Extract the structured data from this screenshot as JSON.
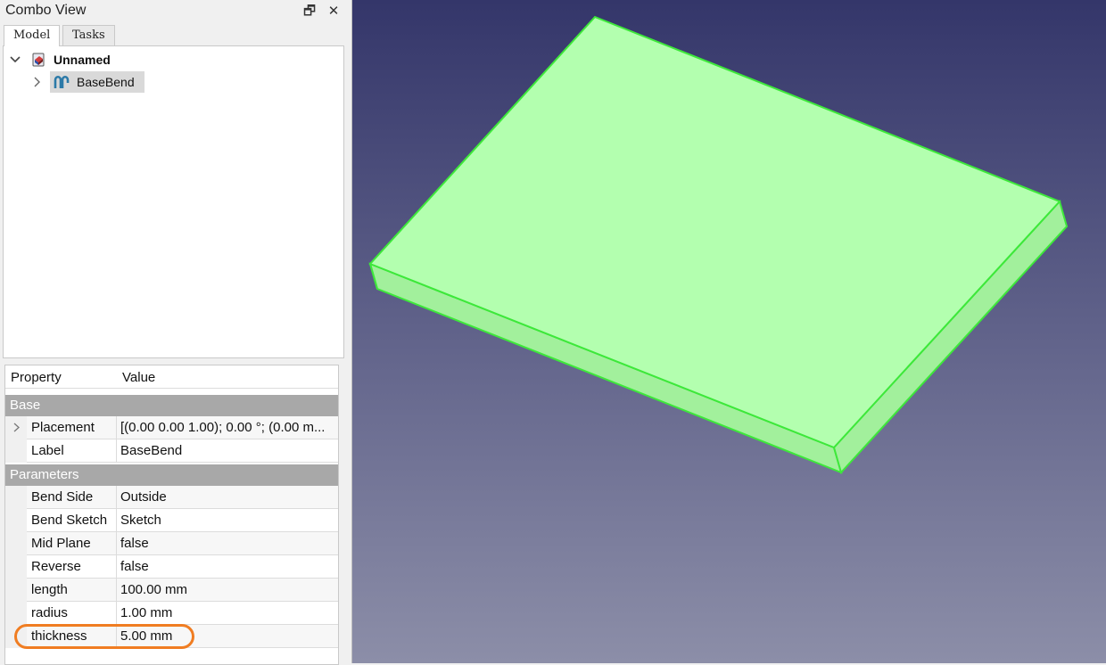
{
  "combo_view": {
    "title": "Combo View",
    "restore_glyph": "🗗",
    "close_glyph": "✕",
    "tabs": [
      {
        "label": "Model",
        "active": true
      },
      {
        "label": "Tasks",
        "active": false
      }
    ]
  },
  "tree": {
    "root": {
      "label": "Unnamed",
      "icon": "document-icon",
      "expanded": true
    },
    "child": {
      "label": "BaseBend",
      "icon": "sheetmetal-bend-icon",
      "selected": true
    }
  },
  "properties": {
    "header": {
      "property": "Property",
      "value": "Value"
    },
    "groups": [
      {
        "name": "Base",
        "rows": [
          {
            "name": "Placement",
            "value": "[(0.00 0.00 1.00); 0.00 °; (0.00 m...",
            "expandable": true
          },
          {
            "name": "Label",
            "value": "BaseBend"
          }
        ]
      },
      {
        "name": "Parameters",
        "rows": [
          {
            "name": "Bend Side",
            "value": "Outside"
          },
          {
            "name": "Bend Sketch",
            "value": "Sketch"
          },
          {
            "name": "Mid Plane",
            "value": "false"
          },
          {
            "name": "Reverse",
            "value": "false"
          },
          {
            "name": "length",
            "value": "100.00 mm"
          },
          {
            "name": "radius",
            "value": "1.00 mm"
          },
          {
            "name": "thickness",
            "value": "5.00 mm",
            "highlighted": true
          }
        ]
      }
    ]
  },
  "colors": {
    "highlight": "#f07d22",
    "solid_top": "#b3ffaf",
    "solid_side": "#a2f09c",
    "solid_edge": "#3de83a",
    "group_bg": "#a8a8a8"
  }
}
